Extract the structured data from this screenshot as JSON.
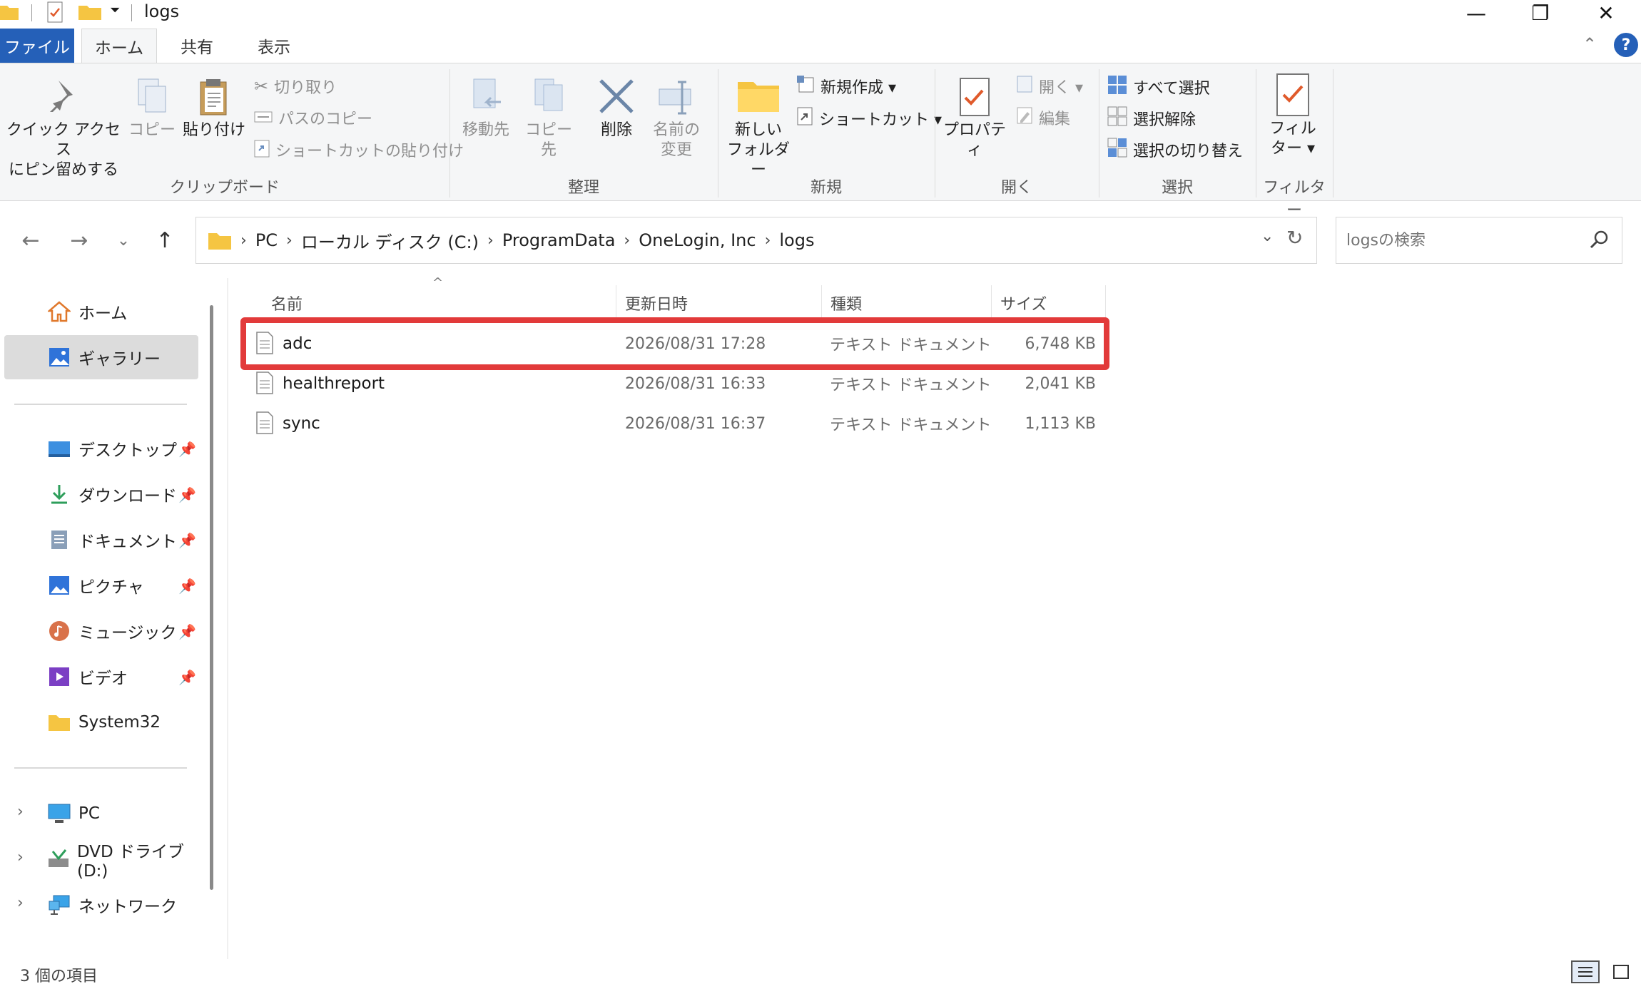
{
  "window": {
    "title": "logs",
    "controls": {
      "minimize": "—",
      "maximize": "❐",
      "close": "✕"
    }
  },
  "tabs": {
    "file": "ファイル",
    "home": "ホーム",
    "share": "共有",
    "view": "表示"
  },
  "ribbon": {
    "clipboard": {
      "label": "クリップボード",
      "pin_line1": "クイック アクセス",
      "pin_line2": "にピン留めする",
      "copy": "コピー",
      "paste": "貼り付け",
      "cut": "切り取り",
      "copy_path": "パスのコピー",
      "paste_shortcut": "ショートカットの貼り付け"
    },
    "organize": {
      "label": "整理",
      "move_to": "移動先",
      "copy_to": "コピー先",
      "delete": "削除",
      "rename_line1": "名前の",
      "rename_line2": "変更"
    },
    "new": {
      "label": "新規",
      "new_folder_line1": "新しい",
      "new_folder_line2": "フォルダー",
      "new_item": "新規作成 ▾",
      "shortcut": "ショートカット ▾"
    },
    "open": {
      "label": "開く",
      "properties": "プロパティ",
      "open": "開く ▾",
      "edit": "編集"
    },
    "select": {
      "label": "選択",
      "select_all": "すべて選択",
      "select_none": "選択解除",
      "invert": "選択の切り替え"
    },
    "filter": {
      "label": "フィルター",
      "btn_line1": "フィル",
      "btn_line2": "ター ▾"
    }
  },
  "address": {
    "crumbs": [
      "PC",
      "ローカル ディスク (C:)",
      "ProgramData",
      "OneLogin, Inc",
      "logs"
    ],
    "separator": "›"
  },
  "search": {
    "placeholder": "logsの検索"
  },
  "sidebar": {
    "home": "ホーム",
    "gallery": "ギャラリー",
    "pinned": [
      {
        "label": "デスクトップ",
        "icon": "desktop-icon"
      },
      {
        "label": "ダウンロード",
        "icon": "download-icon"
      },
      {
        "label": "ドキュメント",
        "icon": "document-icon"
      },
      {
        "label": "ピクチャ",
        "icon": "pictures-icon"
      },
      {
        "label": "ミュージック",
        "icon": "music-icon"
      },
      {
        "label": "ビデオ",
        "icon": "video-icon"
      },
      {
        "label": "System32",
        "icon": "folder-icon"
      }
    ],
    "drives": [
      {
        "label": "PC",
        "icon": "pc-icon"
      },
      {
        "label": "DVD ドライブ (D:)",
        "icon": "dvd-icon"
      },
      {
        "label": "ネットワーク",
        "icon": "network-icon"
      }
    ]
  },
  "columns": {
    "name": "名前",
    "date": "更新日時",
    "type": "種類",
    "size": "サイズ"
  },
  "files": [
    {
      "name": "adc",
      "date": "2026/08/31 17:28",
      "type": "テキスト ドキュメント",
      "size": "6,748 KB"
    },
    {
      "name": "healthreport",
      "date": "2026/08/31 16:33",
      "type": "テキスト ドキュメント",
      "size": "2,041 KB"
    },
    {
      "name": "sync",
      "date": "2026/08/31 16:37",
      "type": "テキスト ドキュメント",
      "size": "1,113 KB"
    }
  ],
  "status": {
    "item_count": "3 個の項目"
  },
  "colors": {
    "accent": "#2560b8",
    "highlight": "#e23a3a",
    "folder": "#f5c542"
  }
}
